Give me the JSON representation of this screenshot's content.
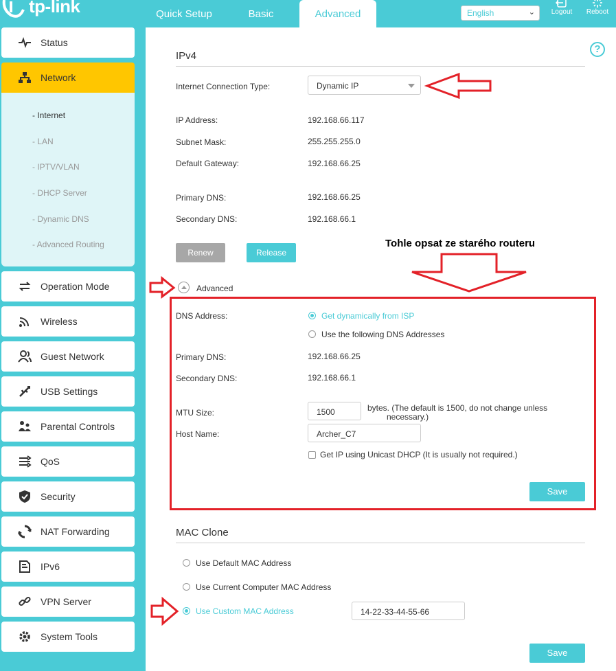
{
  "brand": {
    "logo_text": "tp-link"
  },
  "top_nav": {
    "tabs": [
      {
        "label": "Quick Setup"
      },
      {
        "label": "Basic"
      },
      {
        "label": "Advanced"
      }
    ],
    "language": "English",
    "logout_label": "Logout",
    "reboot_label": "Reboot"
  },
  "sidebar": {
    "items": [
      {
        "label": "Status",
        "icon": "status-pulse-icon"
      },
      {
        "label": "Network",
        "icon": "network-icon"
      },
      {
        "label": "Operation Mode",
        "icon": "operation-mode-icon"
      },
      {
        "label": "Wireless",
        "icon": "wireless-icon"
      },
      {
        "label": "Guest Network",
        "icon": "guest-icon"
      },
      {
        "label": "USB Settings",
        "icon": "usb-icon"
      },
      {
        "label": "Parental Controls",
        "icon": "parental-icon"
      },
      {
        "label": "QoS",
        "icon": "qos-icon"
      },
      {
        "label": "Security",
        "icon": "shield-icon"
      },
      {
        "label": "NAT Forwarding",
        "icon": "nat-icon"
      },
      {
        "label": "IPv6",
        "icon": "ipv6-icon"
      },
      {
        "label": "VPN Server",
        "icon": "vpn-icon"
      },
      {
        "label": "System Tools",
        "icon": "gear-icon"
      }
    ],
    "network_sub": [
      "- Internet",
      "- LAN",
      "- IPTV/VLAN",
      "- DHCP Server",
      "- Dynamic DNS",
      "- Advanced Routing"
    ]
  },
  "ipv4": {
    "title": "IPv4",
    "conn_type_label": "Internet Connection Type:",
    "conn_type_value": "Dynamic IP",
    "ip_label": "IP Address:",
    "ip_value": "192.168.66.117",
    "mask_label": "Subnet Mask:",
    "mask_value": "255.255.255.0",
    "gw_label": "Default Gateway:",
    "gw_value": "192.168.66.25",
    "pdns_label": "Primary DNS:",
    "pdns_value": "192.168.66.25",
    "sdns_label": "Secondary DNS:",
    "sdns_value": "192.168.66.1",
    "renew_label": "Renew",
    "release_label": "Release"
  },
  "advanced": {
    "toggle_label": "Advanced",
    "dns_label": "DNS Address:",
    "dns_opt_dynamic": "Get dynamically from ISP",
    "dns_opt_manual": "Use the following DNS Addresses",
    "pdns_label": "Primary DNS:",
    "pdns_value": "192.168.66.25",
    "sdns_label": "Secondary DNS:",
    "sdns_value": "192.168.66.1",
    "mtu_label": "MTU Size:",
    "mtu_value": "1500",
    "mtu_hint_1": "bytes. (The default is 1500, do not change unless",
    "mtu_hint_2": "necessary.)",
    "host_label": "Host Name:",
    "host_value": "Archer_C7",
    "unicast_label": "Get IP using Unicast DHCP (It is usually not required.)",
    "save_label": "Save"
  },
  "mac_clone": {
    "title": "MAC Clone",
    "opt_default": "Use Default MAC Address",
    "opt_current": "Use Current Computer MAC Address",
    "opt_custom": "Use Custom MAC Address",
    "custom_value": "14-22-33-44-55-66",
    "save_label": "Save"
  },
  "annotation": {
    "text": "Tohle opsat ze starého routeru",
    "color": "#e32128"
  },
  "colors": {
    "accent": "#4acbd6",
    "active_nav": "#ffc600"
  }
}
